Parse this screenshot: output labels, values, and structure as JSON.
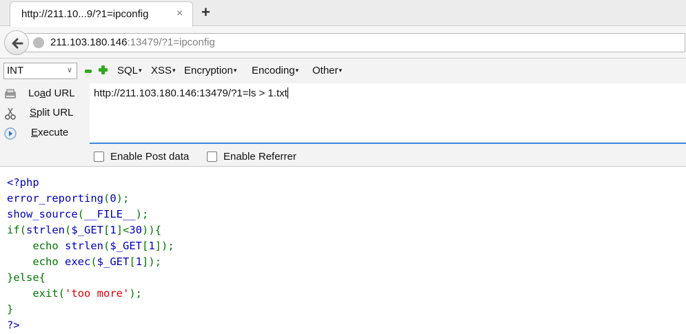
{
  "tab": {
    "title": "http://211.10...9/?1=ipconfig",
    "close": "×",
    "new_tab": "+"
  },
  "address": {
    "host": "211.103.180.146",
    "rest": ":13479/?1=ipconfig"
  },
  "hackbar": {
    "select_value": "INT",
    "menus": [
      "SQL",
      "XSS",
      "Encryption",
      "Encoding",
      "Other"
    ],
    "actions": {
      "load": {
        "pre": "Lo",
        "u": "a",
        "post": "d URL"
      },
      "split": {
        "pre": "",
        "u": "S",
        "post": "plit URL"
      },
      "execute": {
        "pre": "",
        "u": "E",
        "post": "xecute"
      }
    },
    "url_value": "http://211.103.180.146:13479/?1=ls > 1.txt",
    "enable_post": "Enable Post data",
    "enable_referrer": "Enable Referrer"
  },
  "source": {
    "l1": "<?php",
    "l2a": "error_reporting",
    "l2b": "(",
    "l2c": "0",
    "l2d": ");",
    "l3a": "show_source",
    "l3b": "(",
    "l3c": "__FILE__",
    "l3d": ");",
    "l4a": "if(",
    "l4b": "strlen",
    "l4c": "(",
    "l4d": "$_GET",
    "l4e": "[",
    "l4f": "1",
    "l4g": "]<",
    "l4h": "30",
    "l4i": ")){",
    "l5a": "    echo ",
    "l5b": "strlen",
    "l5c": "(",
    "l5d": "$_GET",
    "l5e": "[",
    "l5f": "1",
    "l5g": "]);",
    "l6a": "    echo ",
    "l6b": "exec",
    "l6c": "(",
    "l6d": "$_GET",
    "l6e": "[",
    "l6f": "1",
    "l6g": "]);",
    "l7": "}else{",
    "l8a": "    exit(",
    "l8b": "'too more'",
    "l8c": ");",
    "l9": "}",
    "l10": "?>"
  },
  "colors": {
    "keyword": "#007700",
    "default": "#0000bb",
    "string": "#dd0000",
    "accent": "#3a86d6"
  },
  "icons": [
    "close-icon",
    "plus-icon",
    "back-arrow-icon",
    "globe-icon",
    "minus-icon",
    "add-icon",
    "load-url-icon",
    "split-url-icon",
    "execute-icon"
  ]
}
